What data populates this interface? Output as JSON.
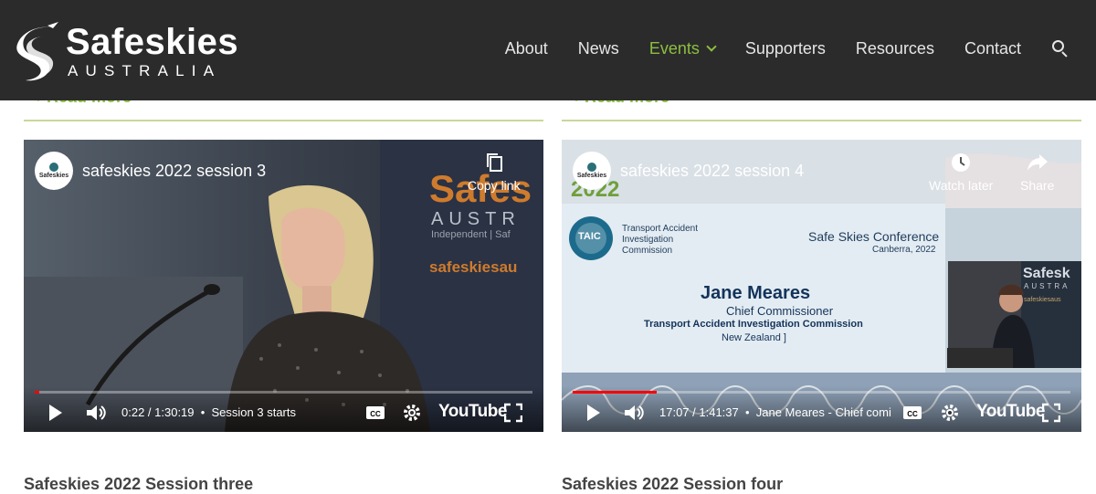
{
  "site": {
    "logo_title": "Safeskies",
    "logo_subtitle": "AUSTRALIA",
    "accent": "#8cbf3f",
    "header_bg": "#2b2b2b"
  },
  "nav": {
    "items": [
      {
        "label": "About"
      },
      {
        "label": "News"
      },
      {
        "label": "Events",
        "active": true
      },
      {
        "label": "Supporters"
      },
      {
        "label": "Resources"
      },
      {
        "label": "Contact"
      }
    ],
    "search_icon": "search-icon"
  },
  "cards": [
    {
      "read_more": "Read more",
      "video": {
        "title": "safeskies 2022 session 3",
        "channel": "Safeskies",
        "top_buttons": [
          "Copy link"
        ],
        "time": "0:22 / 1:30:19",
        "chapter": "Session 3 starts",
        "progress": 0.003,
        "player_logo": "YouTube",
        "slide_brand": "Safes",
        "slide_brand_sub": "AUSTR",
        "slide_tagline": "Independent | Saf",
        "slide_url": "safeskiesau"
      },
      "title": "Safeskies 2022 Session three"
    },
    {
      "read_more": "Read more",
      "video": {
        "title": "safeskies 2022 session 4",
        "channel": "Safeskies",
        "top_buttons": [
          "Watch later",
          "Share"
        ],
        "time": "17:07 / 1:41:37",
        "chapter": "Jane Meares - Chief comi",
        "progress": 0.168,
        "player_logo": "YouTube",
        "slide_year": "2022",
        "slide_org": "Transport Accident Investigation Commission",
        "slide_org_badge": "TAIC",
        "slide_conf": "Safe Skies Conference",
        "slide_conf_place": "Canberra, 2022",
        "speaker_name": "Jane Meares",
        "speaker_role": "Chief Commissioner",
        "speaker_org": "Transport Accident Investigation Commission",
        "speaker_country": "New Zealand ]",
        "inset_brand": "Safesk",
        "inset_brand_sub": "AUSTRA",
        "inset_url": "safeskiesaus"
      },
      "title": "Safeskies 2022 Session four"
    }
  ]
}
